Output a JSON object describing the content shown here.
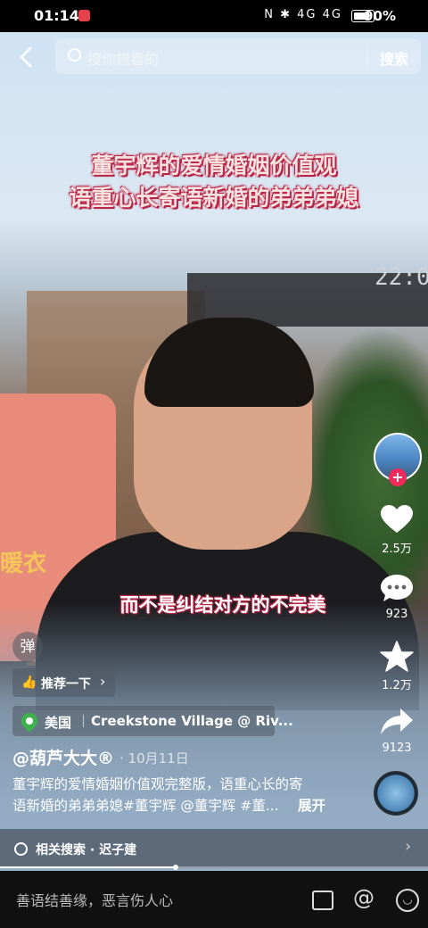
{
  "status_bar": {
    "time": "01:14",
    "icons_text": "N ✱ 4G 4G",
    "battery": "90%"
  },
  "search": {
    "placeholder": "搜你想看的",
    "button": "搜索"
  },
  "video": {
    "title_line1": "董宇辉的爱情婚姻价值观",
    "title_line2": "语重心长寄语新婚的弟弟弟媳",
    "subtitle": "而不是纠结对方的不完美",
    "clock": "22:0",
    "shirt_text": "暖衣"
  },
  "rail": {
    "likes": "2.5万",
    "comments": "923",
    "favorites": "1.2万",
    "shares": "9123"
  },
  "danmu_label": "弹",
  "recommend": {
    "label": "推荐一下"
  },
  "location": {
    "country": "美国",
    "place": "Creekstone Village @ Riv..."
  },
  "post": {
    "author": "@葫芦大大®",
    "date": "· 10月11日",
    "description_line1": "董宇辉的爱情婚姻价值观完整版，语重心长的寄",
    "description_line2": "语新婚的弟弟弟媳#董宇辉 @董宇辉 #董...",
    "expand": "展开"
  },
  "related": {
    "text": "相关搜索 · 迟子建",
    "progress": 0.41
  },
  "comment_bar": {
    "placeholder": "善语结善缘，恶言伤人心"
  }
}
